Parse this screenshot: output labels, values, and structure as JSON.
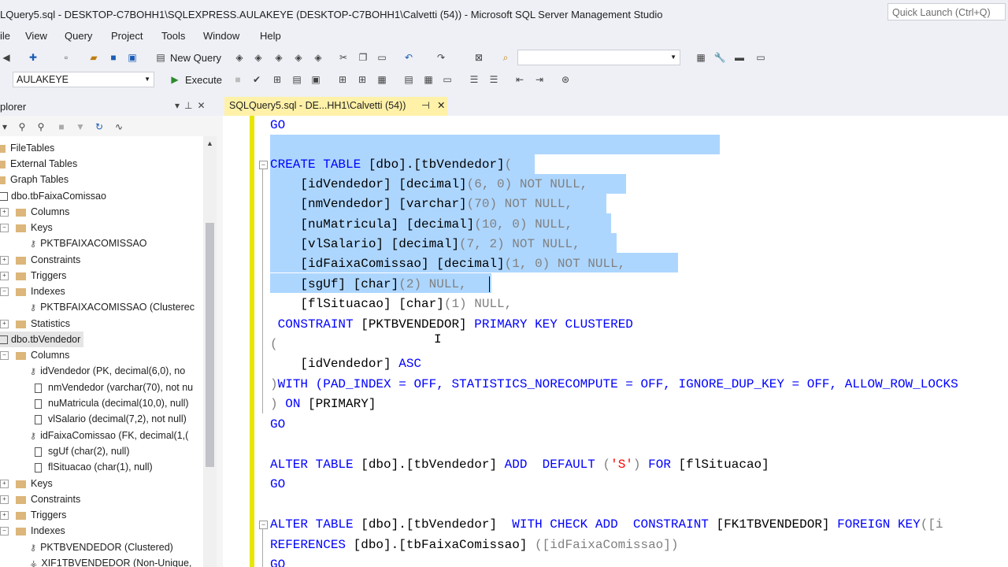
{
  "window": {
    "title": "LQuery5.sql - DESKTOP-C7BOHH1\\SQLEXPRESS.AULAKEYE (DESKTOP-C7BOHH1\\Calvetti (54)) - Microsoft SQL Server Management Studio",
    "quick_launch_placeholder": "Quick Launch (Ctrl+Q)"
  },
  "menu": [
    "ile",
    "View",
    "Query",
    "Project",
    "Tools",
    "Window",
    "Help"
  ],
  "toolbar": {
    "new_query": "New Query",
    "database": "AULAKEYE",
    "execute": "Execute"
  },
  "explorer": {
    "title": "plorer",
    "items": [
      {
        "label": "FileTables"
      },
      {
        "label": "External Tables"
      },
      {
        "label": "Graph Tables"
      },
      {
        "label": "dbo.tbFaixaComissao"
      },
      {
        "label": "Columns"
      },
      {
        "label": "Keys"
      },
      {
        "label": "PKTBFAIXACOMISSAO"
      },
      {
        "label": "Constraints"
      },
      {
        "label": "Triggers"
      },
      {
        "label": "Indexes"
      },
      {
        "label": "PKTBFAIXACOMISSAO (Clusterec"
      },
      {
        "label": "Statistics"
      },
      {
        "label": "dbo.tbVendedor"
      },
      {
        "label": "Columns"
      },
      {
        "label": "idVendedor (PK, decimal(6,0), no"
      },
      {
        "label": "nmVendedor (varchar(70), not nu"
      },
      {
        "label": "nuMatricula (decimal(10,0), null)"
      },
      {
        "label": "vlSalario (decimal(7,2), not null)"
      },
      {
        "label": "idFaixaComissao (FK, decimal(1,("
      },
      {
        "label": "sgUf (char(2), null)"
      },
      {
        "label": "flSituacao (char(1), null)"
      },
      {
        "label": "Keys"
      },
      {
        "label": "Constraints"
      },
      {
        "label": "Triggers"
      },
      {
        "label": "Indexes"
      },
      {
        "label": "PKTBVENDEDOR (Clustered)"
      },
      {
        "label": "XIF1TBVENDEDOR (Non-Unique,"
      }
    ]
  },
  "tab": {
    "label": "SQLQuery5.sql - DE...HH1\\Calvetti (54))"
  },
  "code": {
    "l0": {
      "a": "GO"
    },
    "l1": {
      "a": "CREATE TABLE",
      "b": " [dbo].[tbVendedor]",
      "c": "("
    },
    "l2": {
      "a": "    [idVendedor] [decimal]",
      "b": "(6, 0) NOT NULL,"
    },
    "l3": {
      "a": "    [nmVendedor] [varchar]",
      "b": "(70) NOT NULL,"
    },
    "l4": {
      "a": "    [nuMatricula] [decimal]",
      "b": "(10, 0) NULL,"
    },
    "l5": {
      "a": "    [vlSalario] [decimal]",
      "b": "(7, 2) NOT NULL,"
    },
    "l6": {
      "a": "    [idFaixaComissao] [decimal]",
      "b": "(1, 0) NOT NULL,"
    },
    "l7": {
      "a": "    [sgUf] [char]",
      "b": "(2) NULL,"
    },
    "l8": {
      "a": "    [flSituacao] [char]",
      "b": "(1) NULL,"
    },
    "l9": {
      "a": " CONSTRAINT",
      "b": " [PKTBVENDEDOR]",
      "c": " PRIMARY KEY CLUSTERED"
    },
    "l10": {
      "a": "("
    },
    "l11": {
      "a": "    [idVendedor]",
      "b": " ASC"
    },
    "l12": {
      "a": ")",
      "b": "WITH",
      "c": " (PAD_INDEX = OFF, STATISTICS_NORECOMPUTE = OFF, IGNORE_DUP_KEY = OFF, ALLOW_ROW_LOCKS"
    },
    "l13": {
      "a": ")",
      "b": " ON",
      "c": " [PRIMARY]"
    },
    "l14": {
      "a": "GO"
    },
    "l15": {
      "a": "ALTER TABLE",
      "b": " [dbo].[tbVendedor]",
      "c": " ADD  DEFAULT",
      "d": " (",
      "e": "'S'",
      "f": ")",
      "g": " FOR",
      "h": " [flSituacao]"
    },
    "l16": {
      "a": "GO"
    },
    "l17": {
      "a": "ALTER TABLE",
      "b": " [dbo].[tbVendedor]",
      "c": "  WITH CHECK ADD  CONSTRAINT",
      "d": " [FK1TBVENDEDOR]",
      "e": " FOREIGN KEY",
      "f": "([i"
    },
    "l18": {
      "a": "REFERENCES",
      "b": " [dbo].[tbFaixaComissao]",
      "c": " ([idFaixaComissao])"
    },
    "l19": {
      "a": "GO"
    }
  }
}
